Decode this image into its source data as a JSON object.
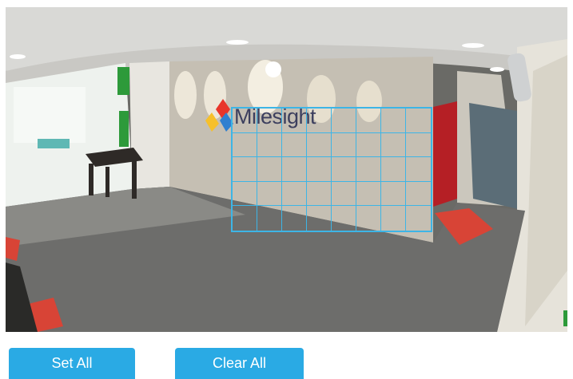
{
  "camera_view": {
    "wall_logo_text": "Milesight",
    "grid": {
      "columns": 8,
      "rows": 5,
      "color": "#3db5e6"
    }
  },
  "actions": {
    "set_all_label": "Set All",
    "clear_all_label": "Clear All",
    "button_color": "#2aaae4"
  }
}
